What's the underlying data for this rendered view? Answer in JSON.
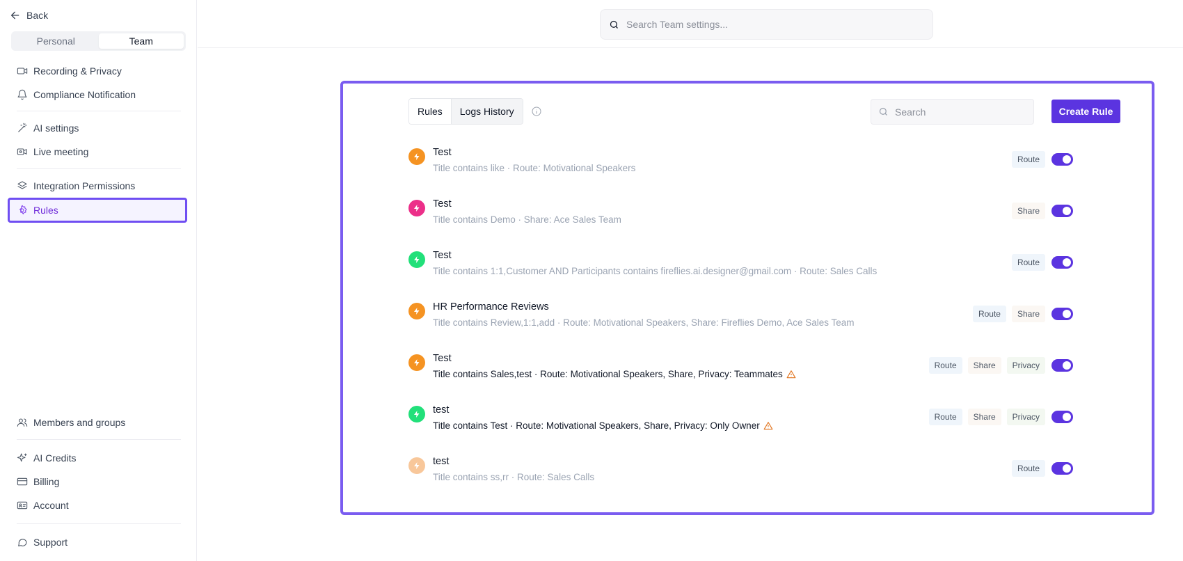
{
  "sidebar": {
    "back_label": "Back",
    "segment": {
      "personal": "Personal",
      "team": "Team",
      "selected": "Team"
    },
    "items": {
      "recording": "Recording & Privacy",
      "compliance": "Compliance Notification",
      "ai_settings": "AI settings",
      "live_meeting": "Live meeting",
      "integration": "Integration Permissions",
      "rules": "Rules",
      "members": "Members and groups",
      "ai_credits": "AI Credits",
      "billing": "Billing",
      "account": "Account",
      "support": "Support"
    },
    "active_item": "Rules"
  },
  "top_search": {
    "placeholder": "Search Team settings..."
  },
  "panel": {
    "tabs": [
      "Rules",
      "Logs History"
    ],
    "search_placeholder": "Search",
    "create_label": "Create Rule"
  },
  "colors": {
    "accent": "#5b34e0",
    "highlight_border": "#7a5cf0",
    "badge_orange": "#f59322",
    "badge_pink": "#ec2f89",
    "badge_green": "#22e07a",
    "badge_peach": "#f8c79a",
    "warning": "#e0731d"
  },
  "rules": [
    {
      "title": "Test",
      "description": "Title contains like · Route: Motivational Speakers",
      "badge_color": "#f59322",
      "tags": [
        "Route"
      ],
      "enabled": true,
      "warning": false
    },
    {
      "title": "Test",
      "description": "Title contains Demo · Share: Ace Sales Team",
      "badge_color": "#ec2f89",
      "tags": [
        "Share"
      ],
      "enabled": true,
      "warning": false
    },
    {
      "title": "Test",
      "description": "Title contains 1:1,Customer AND Participants contains fireflies.ai.designer@gmail.com · Route: Sales Calls",
      "badge_color": "#22e07a",
      "tags": [
        "Route"
      ],
      "enabled": true,
      "warning": false
    },
    {
      "title": "HR Performance Reviews",
      "description": "Title contains Review,1:1,add · Route: Motivational Speakers, Share: Fireflies Demo, Ace Sales Team",
      "badge_color": "#f59322",
      "tags": [
        "Route",
        "Share"
      ],
      "enabled": true,
      "warning": false
    },
    {
      "title": "Test",
      "description": "Title contains Sales,test · Route: Motivational Speakers, Share, Privacy: Teammates",
      "badge_color": "#f59322",
      "tags": [
        "Route",
        "Share",
        "Privacy"
      ],
      "enabled": true,
      "warning": true
    },
    {
      "title": "test",
      "description": "Title contains Test · Route: Motivational Speakers, Share, Privacy: Only Owner",
      "badge_color": "#22e07a",
      "tags": [
        "Route",
        "Share",
        "Privacy"
      ],
      "enabled": true,
      "warning": true
    },
    {
      "title": "test",
      "description": "Title contains ss,rr · Route: Sales Calls",
      "badge_color": "#f8c79a",
      "tags": [
        "Route"
      ],
      "enabled": true,
      "warning": false
    }
  ]
}
